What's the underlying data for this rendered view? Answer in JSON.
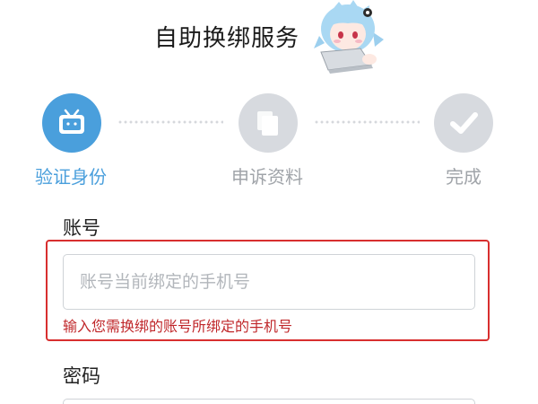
{
  "page": {
    "title": "自助换绑服务",
    "mascot_icon": "mascot-girl-with-laptop"
  },
  "steps": [
    {
      "label": "验证身份",
      "icon": "tv-icon",
      "state": "active"
    },
    {
      "label": "申诉资料",
      "icon": "documents-icon",
      "state": "pending"
    },
    {
      "label": "完成",
      "icon": "checkmark-icon",
      "state": "pending"
    }
  ],
  "form": {
    "account_label": "账号",
    "account_placeholder": "账号当前绑定的手机号",
    "account_hint": "输入您需换绑的账号所绑定的手机号",
    "password_label": "密码"
  },
  "colors": {
    "accent": "#4a9fdc",
    "inactive": "#d7dadf",
    "error": "#d82f2f"
  }
}
